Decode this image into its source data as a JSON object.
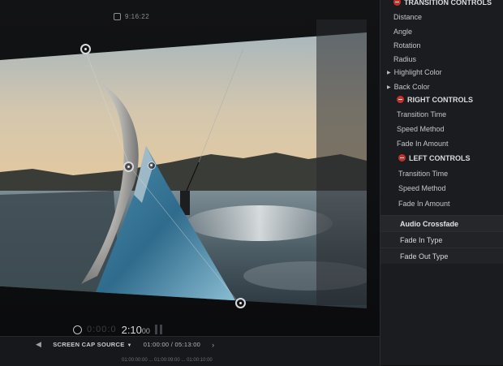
{
  "viewer": {
    "top_timecode": "9:16:22"
  },
  "transport": {
    "dim_digits": "0:00:0",
    "timecode_main": "2:10",
    "timecode_frames": "00"
  },
  "timeline": {
    "source_label": "SCREEN CAP SOURCE",
    "timecode": "01:00:00 / 05:13:00",
    "ticks": "01:00:00:00 ... 01:00:09:00 ... 01:00:10:00"
  },
  "inspector": {
    "transition_controls": "TRANSITION CONTROLS",
    "transition_params": [
      "Distance",
      "Angle",
      "Rotation",
      "Radius"
    ],
    "highlight_color": "Highlight Color",
    "back_color": "Back Color",
    "right_controls": "RIGHT CONTROLS",
    "right_params": [
      "Transition Time",
      "Speed Method",
      "Fade In Amount"
    ],
    "left_controls": "LEFT CONTROLS",
    "left_params": [
      "Transition Time",
      "Speed Method",
      "Fade In Amount"
    ],
    "audio_sections": [
      "Audio Crossfade",
      "Fade In Type",
      "Fade Out Type"
    ]
  },
  "colors": {
    "accent_red": "#c9302c",
    "panel_bg": "#1b1c1f",
    "viewer_bg": "#0c0d0f"
  },
  "icons": [
    "reset-red-icon",
    "disclosure-triangle-icon",
    "transform-handle-icon",
    "play-icon",
    "pause-icon",
    "chevron-left-icon",
    "chevron-right-icon"
  ]
}
